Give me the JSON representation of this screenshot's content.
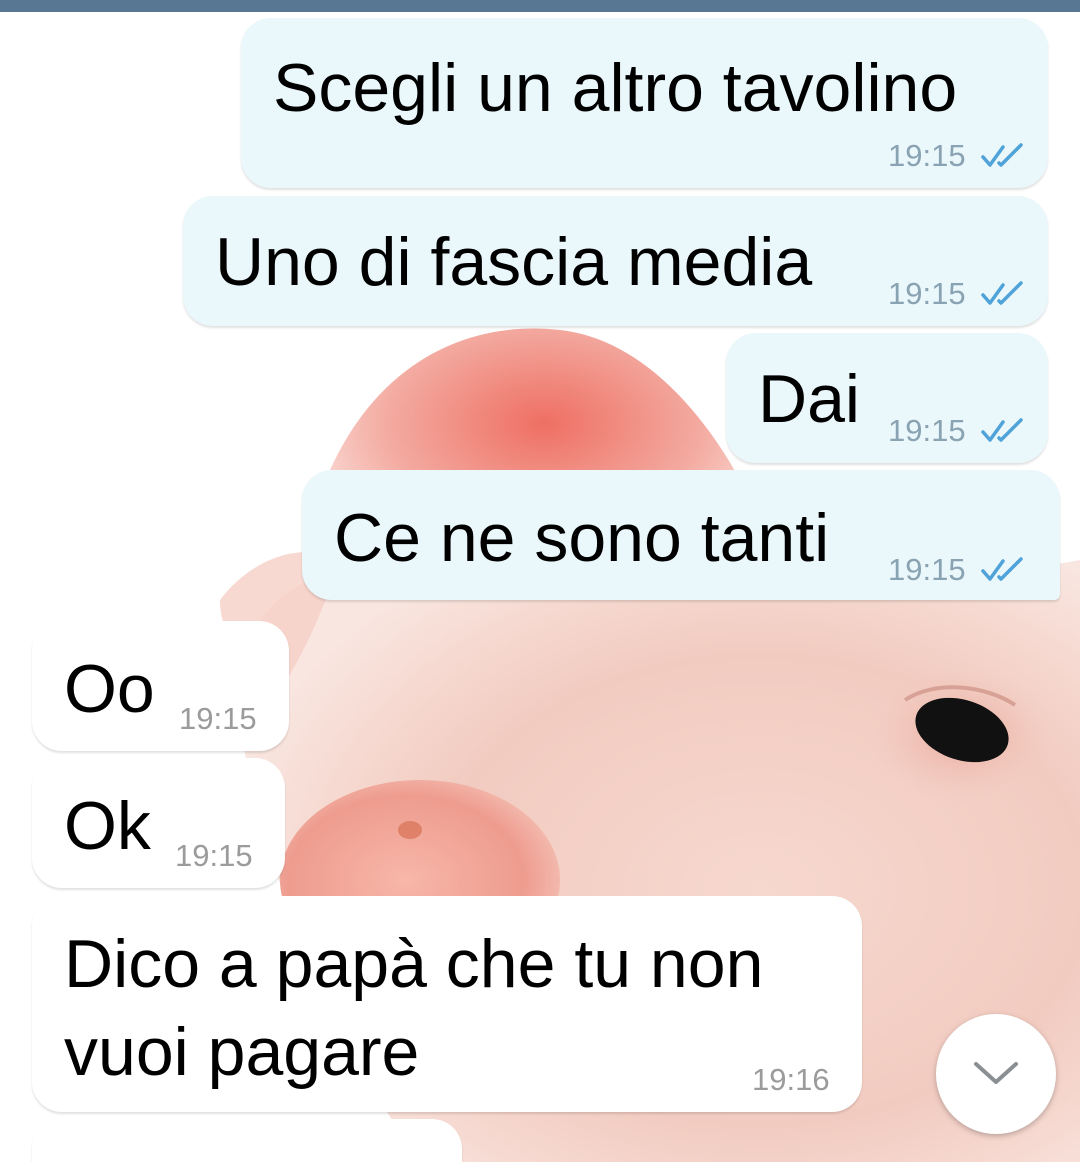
{
  "messages": [
    {
      "text": "Scegli un altro tavolino",
      "time": "19:15",
      "direction": "outgoing",
      "status": "read"
    },
    {
      "text": "Uno di fascia media",
      "time": "19:15",
      "direction": "outgoing",
      "status": "read"
    },
    {
      "text": "Dai",
      "time": "19:15",
      "direction": "outgoing",
      "status": "read"
    },
    {
      "text": "Ce ne sono tanti",
      "time": "19:15",
      "direction": "outgoing",
      "status": "read"
    },
    {
      "text": "Oo",
      "time": "19:15",
      "direction": "incoming"
    },
    {
      "text": "Ok",
      "time": "19:15",
      "direction": "incoming"
    },
    {
      "text_line1": "Dico a papà che tu non",
      "text_line2": "vuoi pagare",
      "time": "19:16",
      "direction": "incoming"
    }
  ],
  "icons": {
    "read_status": "double-check-icon",
    "scroll_button": "chevron-down-icon"
  },
  "colors": {
    "outgoing_bubble": "#eaf7fb",
    "incoming_bubble": "#ffffff",
    "check_marks": "#4fa3d8",
    "header_strip": "#577793"
  }
}
